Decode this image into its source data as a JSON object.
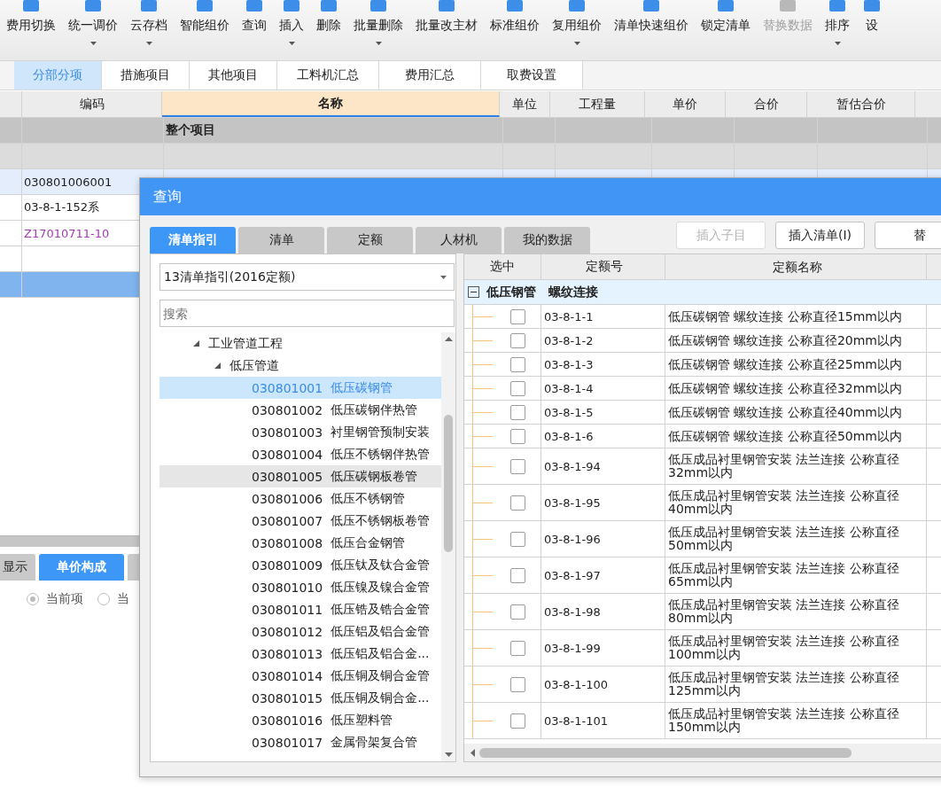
{
  "toolbar": [
    {
      "label": "费用切换",
      "dropdown": false,
      "disabled": false
    },
    {
      "label": "统一调价",
      "dropdown": true,
      "disabled": false
    },
    {
      "label": "云存档",
      "dropdown": true,
      "disabled": false
    },
    {
      "label": "智能组价",
      "dropdown": false,
      "disabled": false
    },
    {
      "label": "查询",
      "dropdown": false,
      "disabled": false
    },
    {
      "label": "插入",
      "dropdown": true,
      "disabled": false
    },
    {
      "label": "删除",
      "dropdown": false,
      "disabled": false
    },
    {
      "label": "批量删除",
      "dropdown": true,
      "disabled": false
    },
    {
      "label": "批量改主材",
      "dropdown": false,
      "disabled": false
    },
    {
      "label": "标准组价",
      "dropdown": false,
      "disabled": false
    },
    {
      "label": "复用组价",
      "dropdown": true,
      "disabled": false
    },
    {
      "label": "清单快速组价",
      "dropdown": false,
      "disabled": false
    },
    {
      "label": "锁定清单",
      "dropdown": false,
      "disabled": false
    },
    {
      "label": "替换数据",
      "dropdown": false,
      "disabled": true
    },
    {
      "label": "排序",
      "dropdown": true,
      "disabled": false
    },
    {
      "label": "设",
      "dropdown": false,
      "disabled": false
    }
  ],
  "tabs": [
    {
      "label": "分部分项",
      "selected": true
    },
    {
      "label": "措施项目",
      "selected": false
    },
    {
      "label": "其他项目",
      "selected": false
    },
    {
      "label": "工料机汇总",
      "selected": false
    },
    {
      "label": "费用汇总",
      "selected": false
    },
    {
      "label": "取费设置",
      "selected": false
    }
  ],
  "table": {
    "columns": [
      "编码",
      "名称",
      "单位",
      "工程量",
      "单价",
      "合价",
      "暂估合价"
    ],
    "rows": [
      {
        "kind": "group",
        "name": "整个项目",
        "selected": false
      },
      {
        "kind": "subgroup",
        "selected": false
      },
      {
        "kind": "bill",
        "code": "030801006001",
        "selected": false
      },
      {
        "kind": "quota",
        "code": "03-8-1-152系",
        "selected": false
      },
      {
        "kind": "material",
        "code": "Z17010711-10",
        "selected": false
      },
      {
        "kind": "quota",
        "selected": false
      },
      {
        "kind": "quota",
        "selected": true
      }
    ]
  },
  "bottom_panel": {
    "tabs": [
      {
        "label": "显示",
        "selected": false
      },
      {
        "label": "单价构成",
        "selected": true
      },
      {
        "selected": false
      }
    ],
    "radios": [
      {
        "label": "当前项",
        "selected": true
      },
      {
        "label": "当",
        "selected": false
      }
    ]
  },
  "dialog": {
    "title": "查询",
    "tabs": [
      {
        "label": "清单指引",
        "selected": true
      },
      {
        "label": "清单",
        "selected": false
      },
      {
        "label": "定额",
        "selected": false
      },
      {
        "label": "人材机",
        "selected": false
      },
      {
        "label": "我的数据",
        "selected": false
      }
    ],
    "buttons": [
      {
        "label": "插入子目",
        "disabled": true
      },
      {
        "label": "插入清单(I)",
        "disabled": false
      },
      {
        "label": "替",
        "disabled": false
      }
    ],
    "dropdown": {
      "value": "13清单指引(2016定额)"
    },
    "search": {
      "placeholder": "搜索"
    },
    "tree": [
      {
        "label": "工业管道工程",
        "expanded": true,
        "children": [
          {
            "label": "低压管道",
            "expanded": true,
            "children": [
              {
                "code": "030801001",
                "name": "低压碳钢管",
                "selected": true,
                "hovered": false
              },
              {
                "code": "030801002",
                "name": "低压碳钢伴热管",
                "selected": false,
                "hovered": false
              },
              {
                "code": "030801003",
                "name": "衬里钢管预制安装",
                "selected": false,
                "hovered": false
              },
              {
                "code": "030801004",
                "name": "低压不锈钢伴热管",
                "selected": false,
                "hovered": false
              },
              {
                "code": "030801005",
                "name": "低压碳钢板卷管",
                "selected": false,
                "hovered": true
              },
              {
                "code": "030801006",
                "name": "低压不锈钢管",
                "selected": false,
                "hovered": false
              },
              {
                "code": "030801007",
                "name": "低压不锈钢板卷管",
                "selected": false,
                "hovered": false
              },
              {
                "code": "030801008",
                "name": "低压合金钢管",
                "selected": false,
                "hovered": false
              },
              {
                "code": "030801009",
                "name": "低压钛及钛合金管",
                "selected": false,
                "hovered": false
              },
              {
                "code": "030801010",
                "name": "低压镍及镍合金管",
                "selected": false,
                "hovered": false
              },
              {
                "code": "030801011",
                "name": "低压锆及锆合金管",
                "selected": false,
                "hovered": false
              },
              {
                "code": "030801012",
                "name": "低压铝及铝合金管",
                "selected": false,
                "hovered": false
              },
              {
                "code": "030801013",
                "name": "低压铝及铝合金...",
                "selected": false,
                "hovered": false
              },
              {
                "code": "030801014",
                "name": "低压铜及铜合金管",
                "selected": false,
                "hovered": false
              },
              {
                "code": "030801015",
                "name": "低压铜及铜合金...",
                "selected": false,
                "hovered": false
              },
              {
                "code": "030801016",
                "name": "低压塑料管",
                "selected": false,
                "hovered": false
              },
              {
                "code": "030801017",
                "name": "金属骨架复合管",
                "selected": false,
                "hovered": false
              }
            ]
          }
        ]
      }
    ],
    "grid": {
      "columns": [
        "选中",
        "定额号",
        "定额名称"
      ],
      "group": {
        "label": "低压钢管　螺纹连接",
        "expanded": true
      },
      "rows": [
        {
          "code": "03-8-1-1",
          "name": "低压碳钢管 螺纹连接 公称直径15mm以内",
          "checked": false
        },
        {
          "code": "03-8-1-2",
          "name": "低压碳钢管 螺纹连接 公称直径20mm以内",
          "checked": false
        },
        {
          "code": "03-8-1-3",
          "name": "低压碳钢管 螺纹连接 公称直径25mm以内",
          "checked": false
        },
        {
          "code": "03-8-1-4",
          "name": "低压碳钢管 螺纹连接 公称直径32mm以内",
          "checked": false
        },
        {
          "code": "03-8-1-5",
          "name": "低压碳钢管 螺纹连接 公称直径40mm以内",
          "checked": false
        },
        {
          "code": "03-8-1-6",
          "name": "低压碳钢管 螺纹连接 公称直径50mm以内",
          "checked": false
        },
        {
          "code": "03-8-1-94",
          "name": "低压成品衬里钢管安装 法兰连接 公称直径32mm以内",
          "checked": false
        },
        {
          "code": "03-8-1-95",
          "name": "低压成品衬里钢管安装 法兰连接 公称直径40mm以内",
          "checked": false
        },
        {
          "code": "03-8-1-96",
          "name": "低压成品衬里钢管安装 法兰连接 公称直径50mm以内",
          "checked": false
        },
        {
          "code": "03-8-1-97",
          "name": "低压成品衬里钢管安装 法兰连接 公称直径65mm以内",
          "checked": false
        },
        {
          "code": "03-8-1-98",
          "name": "低压成品衬里钢管安装 法兰连接 公称直径80mm以内",
          "checked": false
        },
        {
          "code": "03-8-1-99",
          "name": "低压成品衬里钢管安装 法兰连接 公称直径100mm以内",
          "checked": false
        },
        {
          "code": "03-8-1-100",
          "name": "低压成品衬里钢管安装 法兰连接 公称直径125mm以内",
          "checked": false
        },
        {
          "code": "03-8-1-101",
          "name": "低压成品衬里钢管安装 法兰连接 公称直径150mm以内",
          "checked": false
        }
      ]
    }
  }
}
